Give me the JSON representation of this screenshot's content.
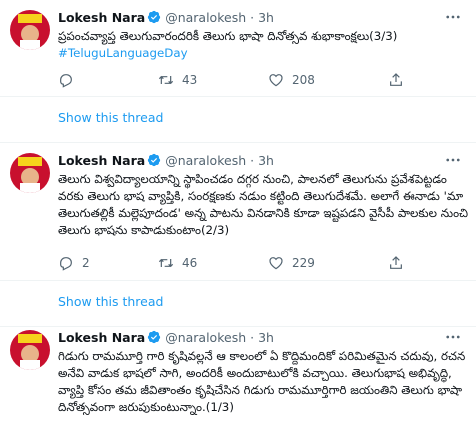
{
  "tweets": [
    {
      "name": "Lokesh Nara",
      "handle": "@naralokesh",
      "sep": "·",
      "time": "3h",
      "text": "ప్రపంచవ్యాప్త తెలుగువారందరికీ తెలుగు భాషా దినోత్సవ శుభాకాంక్షలు(3/3)",
      "hashtag": "#TeluguLanguageDay",
      "replies": "",
      "retweets": "43",
      "likes": "208"
    },
    {
      "name": "Lokesh Nara",
      "handle": "@naralokesh",
      "sep": "·",
      "time": "3h",
      "text": "తెలుగు విశ్వవిద్యాలయాన్ని స్థాపించడం దగ్గర నుంచి, పాలనలో తెలుగును ప్రవేశపెట్టడం వరకు తెలుగు భాష వ్యాప్తికి, సంరక్షణకు నడుం కట్టింది తెలుగుదేశమే. అలాగే ఈనాడు 'మా తెలుగుతల్లికీ మల్లెపూదండ' అన్న పాటను వినడానికి కూడా ఇష్టపడని వైసీపీ పాలకుల నుంచి తెలుగు భాషను కాపాడుకుంటాం(2/3)",
      "replies": "2",
      "retweets": "46",
      "likes": "229"
    },
    {
      "name": "Lokesh Nara",
      "handle": "@naralokesh",
      "sep": "·",
      "time": "3h",
      "text": "గిడుగు రామమూర్తి గారి కృషివల్లనే ఆ కాలంలో ఏ కొద్దిమందికో పరిమితమైన చదువు, రచన అనేవి వాడుక భాషలో సాగి, అందరికీ అందుబాటులోకి వచ్చాయి. తెలుగుభాష అభివృద్ధి, వ్యాప్తి కోసం తమ జీవితాంతం కృషిచేసిన గిడుగు రామమూర్తిగారి జయంతిని తెలుగు భాషా దినోత్సవంగా జరుపుకుంటున్నాం.(1/3)"
    }
  ],
  "show_thread_label": "Show this thread",
  "icons": {
    "reply": "reply-icon",
    "retweet": "retweet-icon",
    "like": "heart-icon",
    "share": "share-icon",
    "more": "more-icon",
    "verified": "verified-badge-icon"
  },
  "colors": {
    "link": "#1d9bf0",
    "muted": "#536471",
    "divider": "#eff3f4",
    "avatar": "#c8102e"
  }
}
